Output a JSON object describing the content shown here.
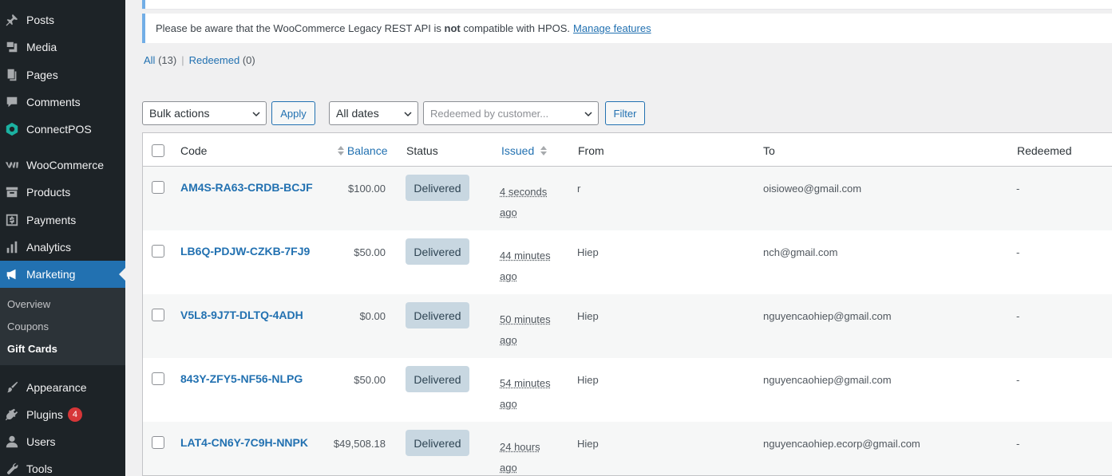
{
  "sidebar": {
    "items": [
      {
        "label": "Posts",
        "icon": "pin-icon"
      },
      {
        "label": "Media",
        "icon": "media-icon"
      },
      {
        "label": "Pages",
        "icon": "pages-icon"
      },
      {
        "label": "Comments",
        "icon": "comment-icon"
      },
      {
        "label": "ConnectPOS",
        "icon": "connectpos-icon"
      },
      {
        "label": "WooCommerce",
        "icon": "woo-icon"
      },
      {
        "label": "Products",
        "icon": "archive-icon"
      },
      {
        "label": "Payments",
        "icon": "dollar-icon"
      },
      {
        "label": "Analytics",
        "icon": "bar-chart-icon"
      },
      {
        "label": "Marketing",
        "icon": "megaphone-icon"
      },
      {
        "label": "Appearance",
        "icon": "brush-icon"
      },
      {
        "label": "Plugins",
        "icon": "plugin-icon",
        "badge": "4"
      },
      {
        "label": "Users",
        "icon": "user-icon"
      },
      {
        "label": "Tools",
        "icon": "wrench-icon"
      }
    ],
    "submenu": [
      "Overview",
      "Coupons",
      "Gift Cards"
    ]
  },
  "notice": {
    "text_before": "Please be aware that the WooCommerce Legacy REST API is ",
    "bold": "not",
    "text_after": " compatible with HPOS.",
    "link": "Manage features"
  },
  "views": {
    "all_label": "All",
    "all_count": "(13)",
    "redeemed_label": "Redeemed",
    "redeemed_count": "(0)",
    "separator": "|"
  },
  "tablenav": {
    "bulk_actions": "Bulk actions",
    "apply": "Apply",
    "dates": "All dates",
    "customer_placeholder": "Redeemed by customer...",
    "filter": "Filter"
  },
  "columns": {
    "code": "Code",
    "balance": "Balance",
    "status": "Status",
    "issued": "Issued",
    "from": "From",
    "to": "To",
    "redeemed": "Redeemed"
  },
  "rows": [
    {
      "code": "AM4S-RA63-CRDB-BCJF",
      "balance": "$100.00",
      "status": "Delivered",
      "issued_1": "4 seconds",
      "issued_2": "ago",
      "from": "r",
      "to": "oisioweo@gmail.com",
      "redeemed": "-"
    },
    {
      "code": "LB6Q-PDJW-CZKB-7FJ9",
      "balance": "$50.00",
      "status": "Delivered",
      "issued_1": "44 minutes",
      "issued_2": "ago",
      "from": "Hiep",
      "to": "nch@gmail.com",
      "redeemed": "-"
    },
    {
      "code": "V5L8-9J7T-DLTQ-4ADH",
      "balance": "$0.00",
      "status": "Delivered",
      "issued_1": "50 minutes",
      "issued_2": "ago",
      "from": "Hiep",
      "to": "nguyencaohiep@gmail.com",
      "redeemed": "-"
    },
    {
      "code": "843Y-ZFY5-NF56-NLPG",
      "balance": "$50.00",
      "status": "Delivered",
      "issued_1": "54 minutes",
      "issued_2": "ago",
      "from": "Hiep",
      "to": "nguyencaohiep@gmail.com",
      "redeemed": "-"
    },
    {
      "code": "LAT4-CN6Y-7C9H-NNPK",
      "balance": "$49,508.18",
      "status": "Delivered",
      "issued_1": "24 hours",
      "issued_2": "ago",
      "from": "Hiep",
      "to": "nguyencaohiep.ecorp@gmail.com",
      "redeemed": "-"
    }
  ],
  "colors": {
    "sidebar_bg": "#1d2327",
    "accent": "#2271b1",
    "status_bg": "#c8d7e1",
    "badge": "#d63638"
  }
}
